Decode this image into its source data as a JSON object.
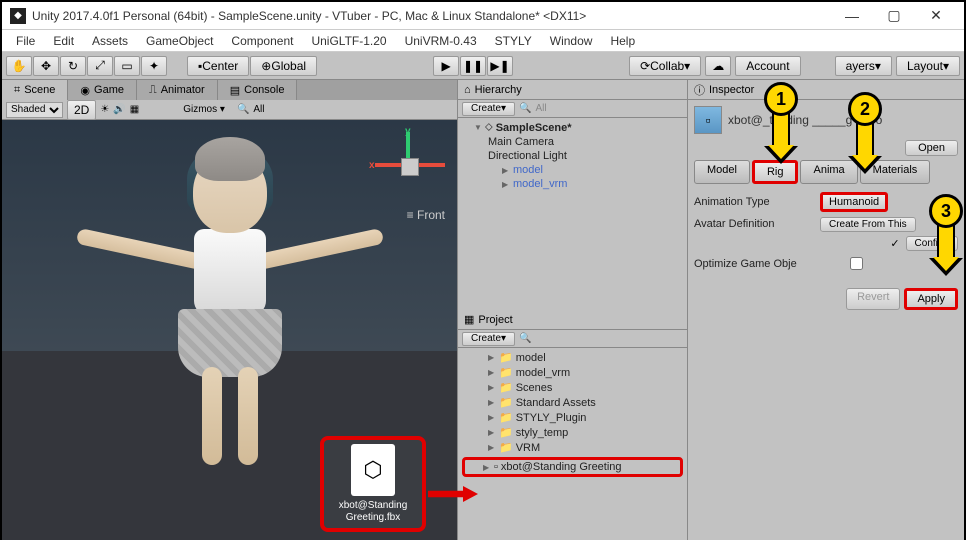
{
  "window": {
    "title": "Unity 2017.4.0f1 Personal (64bit) - SampleScene.unity - VTuber - PC, Mac & Linux Standalone* <DX11>",
    "min": "—",
    "max": "▢",
    "close": "✕"
  },
  "menu": [
    "File",
    "Edit",
    "Assets",
    "GameObject",
    "Component",
    "UniGLTF-1.20",
    "UniVRM-0.43",
    "STYLY",
    "Window",
    "Help"
  ],
  "toolbar": {
    "center": "Center",
    "global": "Global",
    "collab": "Collab",
    "account": "Account",
    "layers": "ayers",
    "layout": "Layout"
  },
  "tabs": {
    "scene": "Scene",
    "game": "Game",
    "animator": "Animator",
    "console": "Console"
  },
  "sceneToolbar": {
    "shaded": "Shaded",
    "mode2d": "2D",
    "gizmos": "Gizmos",
    "all": "All"
  },
  "sceneView": {
    "frontLabel": "≡ Front",
    "gizmo_x": "x",
    "gizmo_y": "y"
  },
  "fileDrop": {
    "name": "xbot@Standing Greeting.fbx"
  },
  "hierarchy": {
    "title": "Hierarchy",
    "create": "Create",
    "search": "All",
    "scene": "SampleScene*",
    "items": [
      "Main Camera",
      "Directional Light",
      "model",
      "model_vrm"
    ]
  },
  "project": {
    "title": "Project",
    "create": "Create",
    "folders": [
      "model",
      "model_vrm",
      "Scenes",
      "Standard Assets",
      "STYLY_Plugin",
      "styly_temp",
      "VRM"
    ],
    "highlighted": "xbot@Standing Greeting"
  },
  "inspector": {
    "title": "Inspector",
    "assetName": "xbot@_tanding _____g Impo",
    "open": "Open",
    "tabs": {
      "model": "Model",
      "rig": "Rig",
      "anim": "Anima",
      "materials": "Materials"
    },
    "animType": {
      "label": "Animation Type",
      "value": "Humanoid"
    },
    "avatarDef": {
      "label": "Avatar Definition",
      "value": "Create From This"
    },
    "configure": "Configu",
    "optimize": "Optimize Game Obje",
    "revert": "Revert",
    "apply": "Apply"
  },
  "callouts": {
    "c1": "1",
    "c2": "2",
    "c3": "3"
  }
}
